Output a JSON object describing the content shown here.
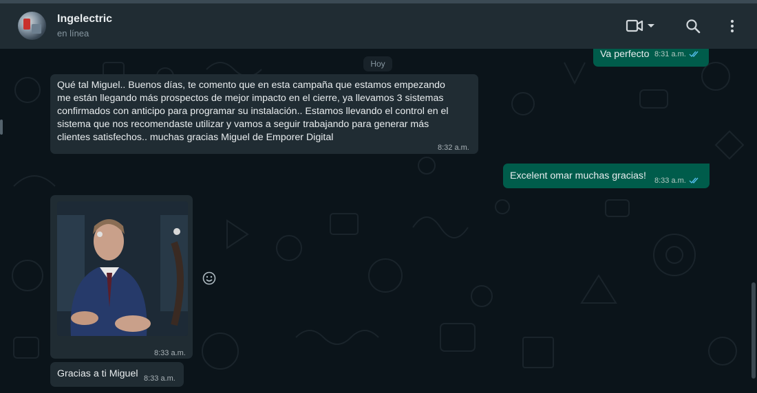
{
  "header": {
    "contact_name": "Ingelectric",
    "status": "en línea"
  },
  "chat": {
    "day_label": "Hoy",
    "messages": [
      {
        "direction": "outgoing",
        "text": "Va perfecto",
        "time": "8:31 a.m.",
        "read": true
      },
      {
        "direction": "incoming",
        "text": "Qué tal Miguel.. Buenos días, te comento que en esta campaña que estamos empezando\nme están llegando más prospectos de mejor impacto en el cierre, ya llevamos 3 sistemas\nconfirmados con anticipo para programar su instalación.. Estamos llevando el control en el\nsistema que nos recomendaste utilizar y vamos a seguir trabajando para generar más\nclientes satisfechos.. muchas gracias Miguel de Emporer Digital",
        "time": "8:32 a.m."
      },
      {
        "direction": "outgoing",
        "text": "Excelent omar muchas gracias!",
        "time": "8:33 a.m.",
        "read": true
      },
      {
        "direction": "incoming",
        "type": "image",
        "time": "8:33 a.m."
      },
      {
        "direction": "incoming",
        "text": "Gracias a ti Miguel",
        "time": "8:33 a.m."
      }
    ]
  },
  "icons": {
    "video": "video-call-icon",
    "search": "search-icon",
    "menu": "menu-dots-icon",
    "emoji": "emoji-icon",
    "read": "double-check-icon"
  },
  "colors": {
    "header_bg": "#202c33",
    "chat_bg": "#0b141a",
    "incoming_bubble": "#202c33",
    "outgoing_bubble": "#005c4b",
    "read_ticks": "#53bdeb"
  }
}
